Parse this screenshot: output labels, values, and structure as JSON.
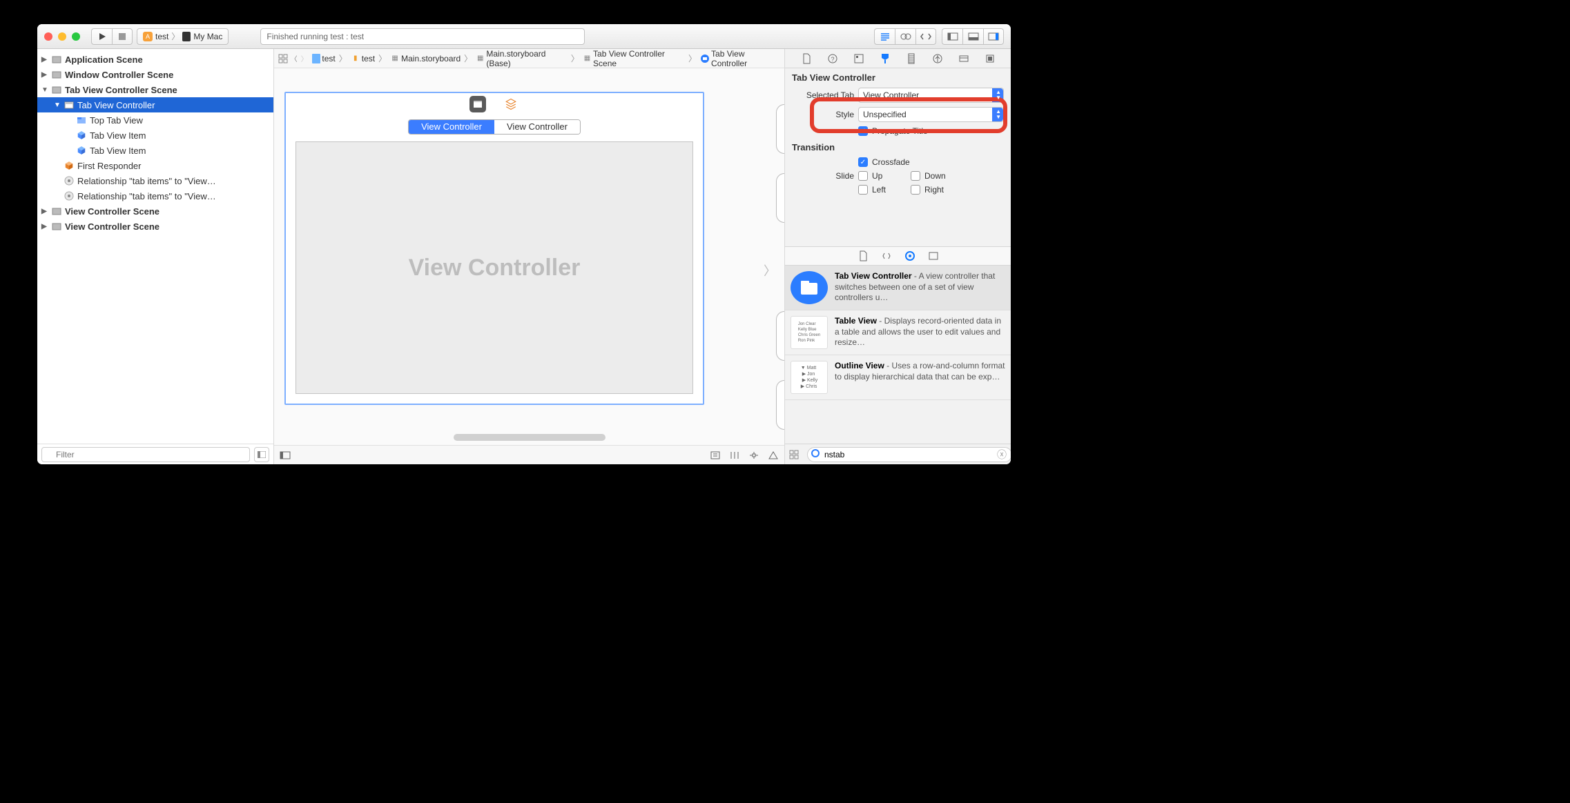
{
  "toolbar": {
    "scheme": "test",
    "device": "My Mac",
    "status": "Finished running test : test"
  },
  "jumpbar": [
    "test",
    "test",
    "Main.storyboard",
    "Main.storyboard (Base)",
    "Tab View Controller Scene",
    "Tab View Controller"
  ],
  "navigator": {
    "items": [
      {
        "label": "Application Scene",
        "depth": 0,
        "bold": true,
        "disclosure": "▶",
        "icon": "scene"
      },
      {
        "label": "Window Controller Scene",
        "depth": 0,
        "bold": true,
        "disclosure": "▶",
        "icon": "scene"
      },
      {
        "label": "Tab View Controller Scene",
        "depth": 0,
        "bold": true,
        "disclosure": "▼",
        "icon": "scene"
      },
      {
        "label": "Tab View Controller",
        "depth": 1,
        "bold": false,
        "disclosure": "▼",
        "icon": "vc",
        "selected": true
      },
      {
        "label": "Top Tab View",
        "depth": 2,
        "bold": false,
        "disclosure": "",
        "icon": "tabview"
      },
      {
        "label": "Tab View Item",
        "depth": 2,
        "bold": false,
        "disclosure": "",
        "icon": "cube"
      },
      {
        "label": "Tab View Item",
        "depth": 2,
        "bold": false,
        "disclosure": "",
        "icon": "cube"
      },
      {
        "label": "First Responder",
        "depth": 1,
        "bold": false,
        "disclosure": "",
        "icon": "fr"
      },
      {
        "label": "Relationship \"tab items\" to \"View…",
        "depth": 1,
        "bold": false,
        "disclosure": "",
        "icon": "rel"
      },
      {
        "label": "Relationship \"tab items\" to \"View…",
        "depth": 1,
        "bold": false,
        "disclosure": "",
        "icon": "rel"
      },
      {
        "label": "View Controller Scene",
        "depth": 0,
        "bold": true,
        "disclosure": "▶",
        "icon": "scene"
      },
      {
        "label": "View Controller Scene",
        "depth": 0,
        "bold": true,
        "disclosure": "▶",
        "icon": "scene"
      }
    ],
    "filter_placeholder": "Filter"
  },
  "canvas": {
    "tab_active": "View Controller",
    "tab_inactive": "View Controller",
    "placeholder": "View Controller"
  },
  "inspector": {
    "section": "Tab View Controller",
    "selected_tab_label": "Selected Tab",
    "selected_tab_value": "View Controller",
    "style_label": "Style",
    "style_value": "Unspecified",
    "propagate_label": "Propagate Title",
    "transition_title": "Transition",
    "crossfade_label": "Crossfade",
    "slide_label": "Slide",
    "up": "Up",
    "down": "Down",
    "left": "Left",
    "right": "Right"
  },
  "library": {
    "items": [
      {
        "title": "Tab View Controller",
        "desc": " - A view controller that switches between one of a set of view controllers u…",
        "selected": true
      },
      {
        "title": "Table View",
        "desc": " - Displays record-oriented data in a table and allows the user to edit values and resize…",
        "selected": false
      },
      {
        "title": "Outline View",
        "desc": " - Uses a row-and-column format to display hierarchical data that can be exp…",
        "selected": false
      }
    ],
    "filter_value": "nstab"
  }
}
